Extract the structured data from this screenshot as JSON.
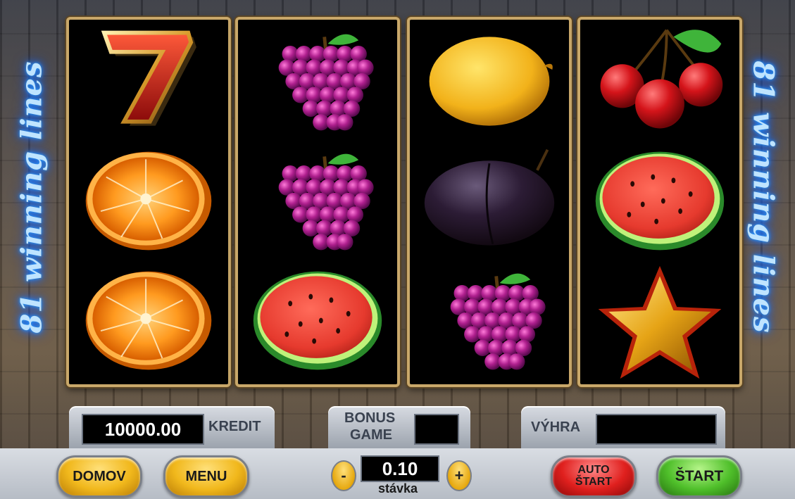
{
  "side_text": {
    "left": "81 winning lines",
    "right": "81 winning lines"
  },
  "reels": [
    [
      "seven",
      "orange",
      "orange"
    ],
    [
      "grapes",
      "grapes",
      "watermelon"
    ],
    [
      "lemon",
      "plum",
      "grapes"
    ],
    [
      "cherries",
      "watermelon",
      "star"
    ]
  ],
  "credit": {
    "value": "10000.00",
    "label": "KREDIT"
  },
  "bonus": {
    "label_line1": "BONUS",
    "label_line2": "GAME",
    "value": ""
  },
  "win": {
    "label": "VÝHRA",
    "value": ""
  },
  "bet": {
    "value": "0.10",
    "label": "stávka",
    "decrease": "-",
    "increase": "+"
  },
  "buttons": {
    "home": "DOMOV",
    "menu": "MENU",
    "auto_line1": "AUTO",
    "auto_line2": "ŠTART",
    "start": "ŠTART"
  },
  "colors": {
    "neon": "#bfe4ff",
    "reel_border": "#c9a86a",
    "yellow": "#f1b81c",
    "red": "#e0201e",
    "green": "#4fbf2a"
  }
}
